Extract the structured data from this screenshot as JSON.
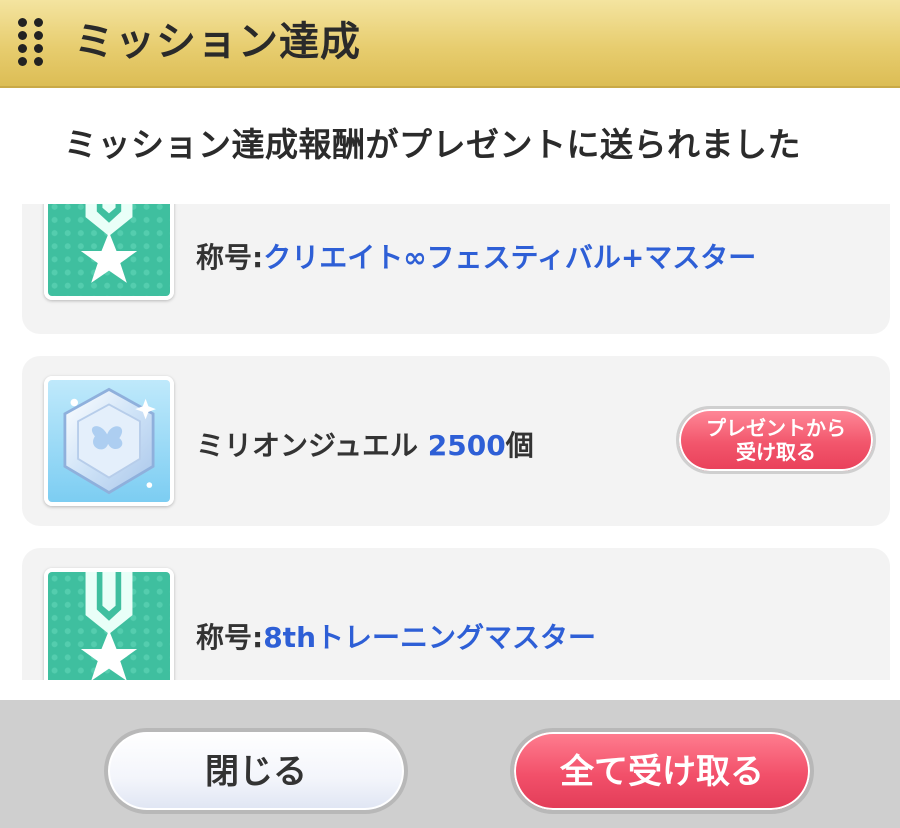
{
  "header": {
    "title": "ミッション達成",
    "menu_icon": "drag-grip-icon"
  },
  "message": "ミッション達成報酬がプレゼントに送られました",
  "rewards": [
    {
      "icon": "medal-ribbon-icon",
      "prefix": "称号:",
      "name": "クリエイト∞フェスティバル+マスター",
      "quantity": "",
      "unit": ""
    },
    {
      "icon": "million-jewel-icon",
      "prefix": "",
      "name": "ミリオンジュエル",
      "quantity": "2500",
      "unit": "個",
      "present_button": {
        "line1": "プレゼントから",
        "line2": "受け取る"
      }
    },
    {
      "icon": "medal-ribbon-icon",
      "prefix": "称号:",
      "name": "8thトレーニングマスター",
      "quantity": "",
      "unit": ""
    }
  ],
  "footer": {
    "close_label": "閉じる",
    "receive_all_label": "全て受け取る"
  },
  "colors": {
    "header": "#e7cd6f",
    "highlight_text": "#2e5fd6",
    "accent_pink": "#f2506a",
    "card_bg": "#f3f3f3",
    "footer_bg": "#cfcfcf"
  }
}
